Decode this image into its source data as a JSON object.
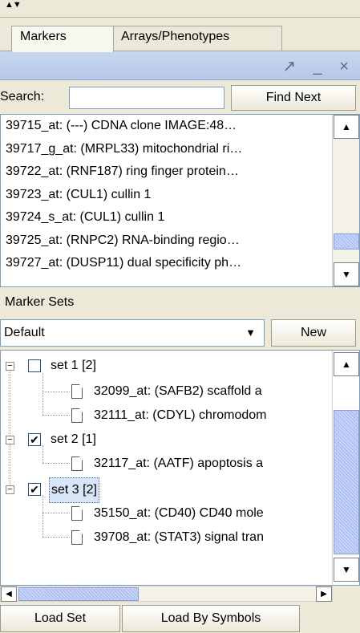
{
  "splitter": {
    "arrows": "▲▼"
  },
  "tabs": [
    {
      "label": "Markers"
    },
    {
      "label": "Arrays/Phenotypes"
    }
  ],
  "panel": {
    "controls": "↗ _ ×"
  },
  "search": {
    "label": "Search:",
    "value": "",
    "find_next": "Find Next"
  },
  "markers": [
    "39715_at: (---) CDNA clone IMAGE:48…",
    "39717_g_at: (MRPL33) mitochondrial ri…",
    "39722_at: (RNF187) ring finger protein…",
    "39723_at: (CUL1) cullin 1",
    "39724_s_at: (CUL1) cullin 1",
    "39725_at: (RNPC2) RNA-binding regio…",
    "39727_at: (DUSP11) dual specificity ph…"
  ],
  "marker_sets": {
    "header": "Marker Sets",
    "selected_set": "Default",
    "new_label": "New",
    "tree": [
      {
        "label": "set 1 [2]",
        "checked": false,
        "children": [
          "32099_at: (SAFB2) scaffold a",
          "32111_at: (CDYL) chromodom"
        ]
      },
      {
        "label": "set 2 [1]",
        "checked": true,
        "children": [
          "32117_at: (AATF) apoptosis a"
        ]
      },
      {
        "label": "set 3 [2]",
        "checked": true,
        "children": [
          "35150_at: (CD40) CD40 mole",
          "39708_at: (STAT3) signal tran"
        ]
      }
    ]
  },
  "bottom": {
    "load_set": "Load Set",
    "load_by_symbols": "Load By Symbols"
  },
  "colors": {
    "panel_title": "#c9d7ee",
    "selection": "#d8e4f8",
    "scroll_thumb": "#c3d3fd",
    "background": "#ece9d8"
  }
}
